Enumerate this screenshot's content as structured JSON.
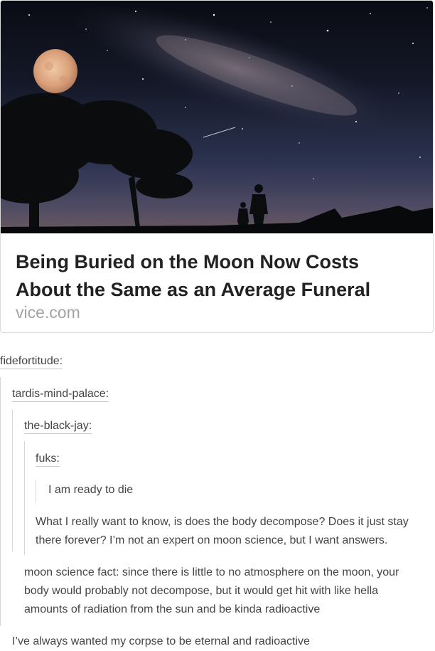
{
  "link_card": {
    "headline": "Being Buried on the Moon Now Costs About the Same as an Average Funeral",
    "source": "vice.com",
    "image": "night-sky-moon-silhouette"
  },
  "reblog_chain": {
    "user1": "fidefortitude",
    "user2": "tardis-mind-palace",
    "user3": "the-black-jay",
    "user4": "fuks",
    "colon": ":"
  },
  "posts": {
    "fuks_text": "I am ready to die",
    "black_jay_line1": "What I really want to know, is does the body decompose? Does it just stay",
    "black_jay_line2": "there forever? I’m not an expert on moon science, but I want answers.",
    "tardis_line1": "moon science fact: since there is little to no atmosphere on the moon, your",
    "tardis_line2": "body would probably not decompose, but it would get hit with like hella",
    "tardis_line3": "amounts of radiation from the sun and be kinda radioactive",
    "fidefortitude_text": "I’ve always wanted my corpse to be eternal and radioactive"
  }
}
